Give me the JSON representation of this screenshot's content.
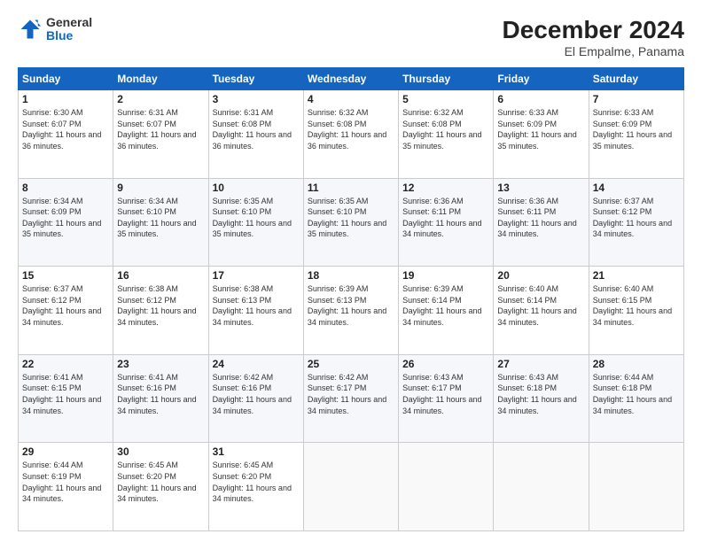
{
  "header": {
    "logo": {
      "general": "General",
      "blue": "Blue"
    },
    "title": "December 2024",
    "subtitle": "El Empalme, Panama"
  },
  "days_of_week": [
    "Sunday",
    "Monday",
    "Tuesday",
    "Wednesday",
    "Thursday",
    "Friday",
    "Saturday"
  ],
  "weeks": [
    [
      {
        "day": "1",
        "sunrise": "6:30 AM",
        "sunset": "6:07 PM",
        "daylight": "11 hours and 36 minutes."
      },
      {
        "day": "2",
        "sunrise": "6:31 AM",
        "sunset": "6:07 PM",
        "daylight": "11 hours and 36 minutes."
      },
      {
        "day": "3",
        "sunrise": "6:31 AM",
        "sunset": "6:08 PM",
        "daylight": "11 hours and 36 minutes."
      },
      {
        "day": "4",
        "sunrise": "6:32 AM",
        "sunset": "6:08 PM",
        "daylight": "11 hours and 36 minutes."
      },
      {
        "day": "5",
        "sunrise": "6:32 AM",
        "sunset": "6:08 PM",
        "daylight": "11 hours and 35 minutes."
      },
      {
        "day": "6",
        "sunrise": "6:33 AM",
        "sunset": "6:09 PM",
        "daylight": "11 hours and 35 minutes."
      },
      {
        "day": "7",
        "sunrise": "6:33 AM",
        "sunset": "6:09 PM",
        "daylight": "11 hours and 35 minutes."
      }
    ],
    [
      {
        "day": "8",
        "sunrise": "6:34 AM",
        "sunset": "6:09 PM",
        "daylight": "11 hours and 35 minutes."
      },
      {
        "day": "9",
        "sunrise": "6:34 AM",
        "sunset": "6:10 PM",
        "daylight": "11 hours and 35 minutes."
      },
      {
        "day": "10",
        "sunrise": "6:35 AM",
        "sunset": "6:10 PM",
        "daylight": "11 hours and 35 minutes."
      },
      {
        "day": "11",
        "sunrise": "6:35 AM",
        "sunset": "6:10 PM",
        "daylight": "11 hours and 35 minutes."
      },
      {
        "day": "12",
        "sunrise": "6:36 AM",
        "sunset": "6:11 PM",
        "daylight": "11 hours and 34 minutes."
      },
      {
        "day": "13",
        "sunrise": "6:36 AM",
        "sunset": "6:11 PM",
        "daylight": "11 hours and 34 minutes."
      },
      {
        "day": "14",
        "sunrise": "6:37 AM",
        "sunset": "6:12 PM",
        "daylight": "11 hours and 34 minutes."
      }
    ],
    [
      {
        "day": "15",
        "sunrise": "6:37 AM",
        "sunset": "6:12 PM",
        "daylight": "11 hours and 34 minutes."
      },
      {
        "day": "16",
        "sunrise": "6:38 AM",
        "sunset": "6:12 PM",
        "daylight": "11 hours and 34 minutes."
      },
      {
        "day": "17",
        "sunrise": "6:38 AM",
        "sunset": "6:13 PM",
        "daylight": "11 hours and 34 minutes."
      },
      {
        "day": "18",
        "sunrise": "6:39 AM",
        "sunset": "6:13 PM",
        "daylight": "11 hours and 34 minutes."
      },
      {
        "day": "19",
        "sunrise": "6:39 AM",
        "sunset": "6:14 PM",
        "daylight": "11 hours and 34 minutes."
      },
      {
        "day": "20",
        "sunrise": "6:40 AM",
        "sunset": "6:14 PM",
        "daylight": "11 hours and 34 minutes."
      },
      {
        "day": "21",
        "sunrise": "6:40 AM",
        "sunset": "6:15 PM",
        "daylight": "11 hours and 34 minutes."
      }
    ],
    [
      {
        "day": "22",
        "sunrise": "6:41 AM",
        "sunset": "6:15 PM",
        "daylight": "11 hours and 34 minutes."
      },
      {
        "day": "23",
        "sunrise": "6:41 AM",
        "sunset": "6:16 PM",
        "daylight": "11 hours and 34 minutes."
      },
      {
        "day": "24",
        "sunrise": "6:42 AM",
        "sunset": "6:16 PM",
        "daylight": "11 hours and 34 minutes."
      },
      {
        "day": "25",
        "sunrise": "6:42 AM",
        "sunset": "6:17 PM",
        "daylight": "11 hours and 34 minutes."
      },
      {
        "day": "26",
        "sunrise": "6:43 AM",
        "sunset": "6:17 PM",
        "daylight": "11 hours and 34 minutes."
      },
      {
        "day": "27",
        "sunrise": "6:43 AM",
        "sunset": "6:18 PM",
        "daylight": "11 hours and 34 minutes."
      },
      {
        "day": "28",
        "sunrise": "6:44 AM",
        "sunset": "6:18 PM",
        "daylight": "11 hours and 34 minutes."
      }
    ],
    [
      {
        "day": "29",
        "sunrise": "6:44 AM",
        "sunset": "6:19 PM",
        "daylight": "11 hours and 34 minutes."
      },
      {
        "day": "30",
        "sunrise": "6:45 AM",
        "sunset": "6:20 PM",
        "daylight": "11 hours and 34 minutes."
      },
      {
        "day": "31",
        "sunrise": "6:45 AM",
        "sunset": "6:20 PM",
        "daylight": "11 hours and 34 minutes."
      },
      null,
      null,
      null,
      null
    ]
  ],
  "labels": {
    "sunrise_prefix": "Sunrise: ",
    "sunset_prefix": "Sunset: ",
    "daylight_prefix": "Daylight: "
  }
}
